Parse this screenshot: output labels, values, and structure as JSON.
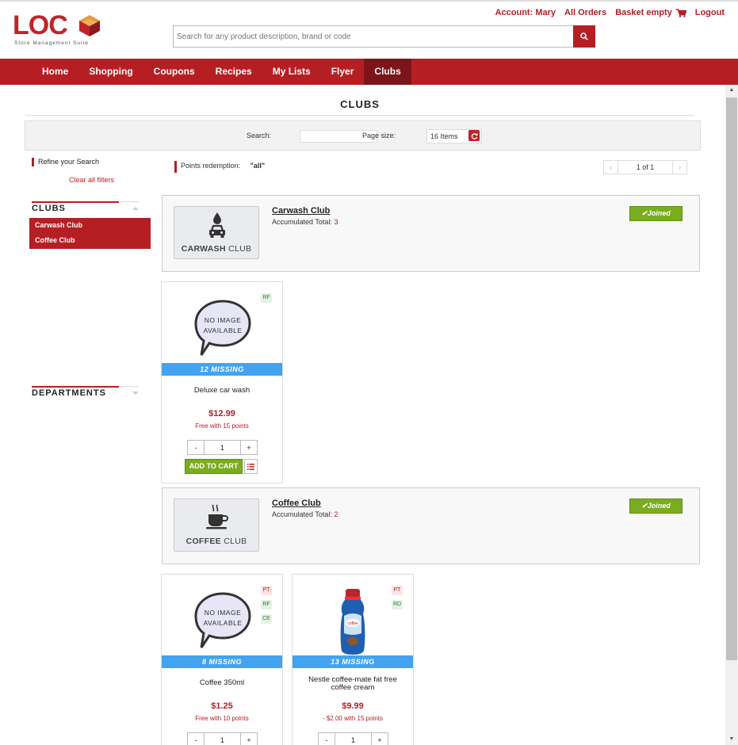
{
  "header": {
    "logo_text": "LOC",
    "logo_subtitle": "Store Management Suite",
    "links": {
      "account": "Account: Mary",
      "orders": "All Orders",
      "basket": "Basket empty",
      "logout": "Logout"
    },
    "search_placeholder": "Search for any product description, brand or code"
  },
  "nav": [
    "Home",
    "Shopping",
    "Coupons",
    "Recipes",
    "My Lists",
    "Flyer",
    "Clubs"
  ],
  "nav_active": "Clubs",
  "page": {
    "title": "CLUBS",
    "search_label": "Search:",
    "page_size_label": "Page size:",
    "page_size_value": "16 Items",
    "points_label": "Points redemption:",
    "points_value": "\"all\"",
    "pager": "1 of 1"
  },
  "sidebar": {
    "refine": "Refine your Search",
    "clear": "Clear all filters",
    "clubs_heading": "CLUBS",
    "clubs": [
      "Carwash Club",
      "Coffee Club"
    ],
    "departments_heading": "DEPARTMENTS"
  },
  "clubs": [
    {
      "name": "Carwash Club",
      "total_label": "Accumulated Total:",
      "total": "3",
      "status": "Joined",
      "image_caption_bold": "CARWASH",
      "image_caption": "CLUB"
    },
    {
      "name": "Coffee Club",
      "total_label": "Accumulated Total:",
      "total": "2",
      "status": "Joined",
      "image_caption_bold": "COFFEE",
      "image_caption": "CLUB"
    }
  ],
  "products": [
    {
      "name": "Deluxe car wash",
      "missing": "12 MISSING",
      "price": "$12.99",
      "offer": "Free with 15 points",
      "qty": "1",
      "tags": [
        "RF"
      ],
      "no_image_text": "NO IMAGE AVAILABLE"
    },
    {
      "name": "Coffee 350ml",
      "missing": "8 MISSING",
      "price": "$1.25",
      "offer": "Free with 10 points",
      "qty": "1",
      "tags": [
        "PT",
        "RF",
        "CE"
      ],
      "no_image_text": "NO IMAGE AVAILABLE"
    },
    {
      "name": "Nestle coffee-mate fat free coffee cream",
      "missing": "13 MISSING",
      "price": "$9.99",
      "offer": "- $2.00 with 15 points",
      "qty": "1",
      "tags": [
        "PT",
        "RD"
      ]
    }
  ],
  "buttons": {
    "add_to_cart": "ADD TO CART",
    "minus": "-",
    "plus": "+"
  },
  "colors": {
    "brand_red": "#b51f24",
    "nav_active": "#7b1519",
    "missing_blue": "#43a3f0",
    "action_green": "#79ad1d"
  }
}
